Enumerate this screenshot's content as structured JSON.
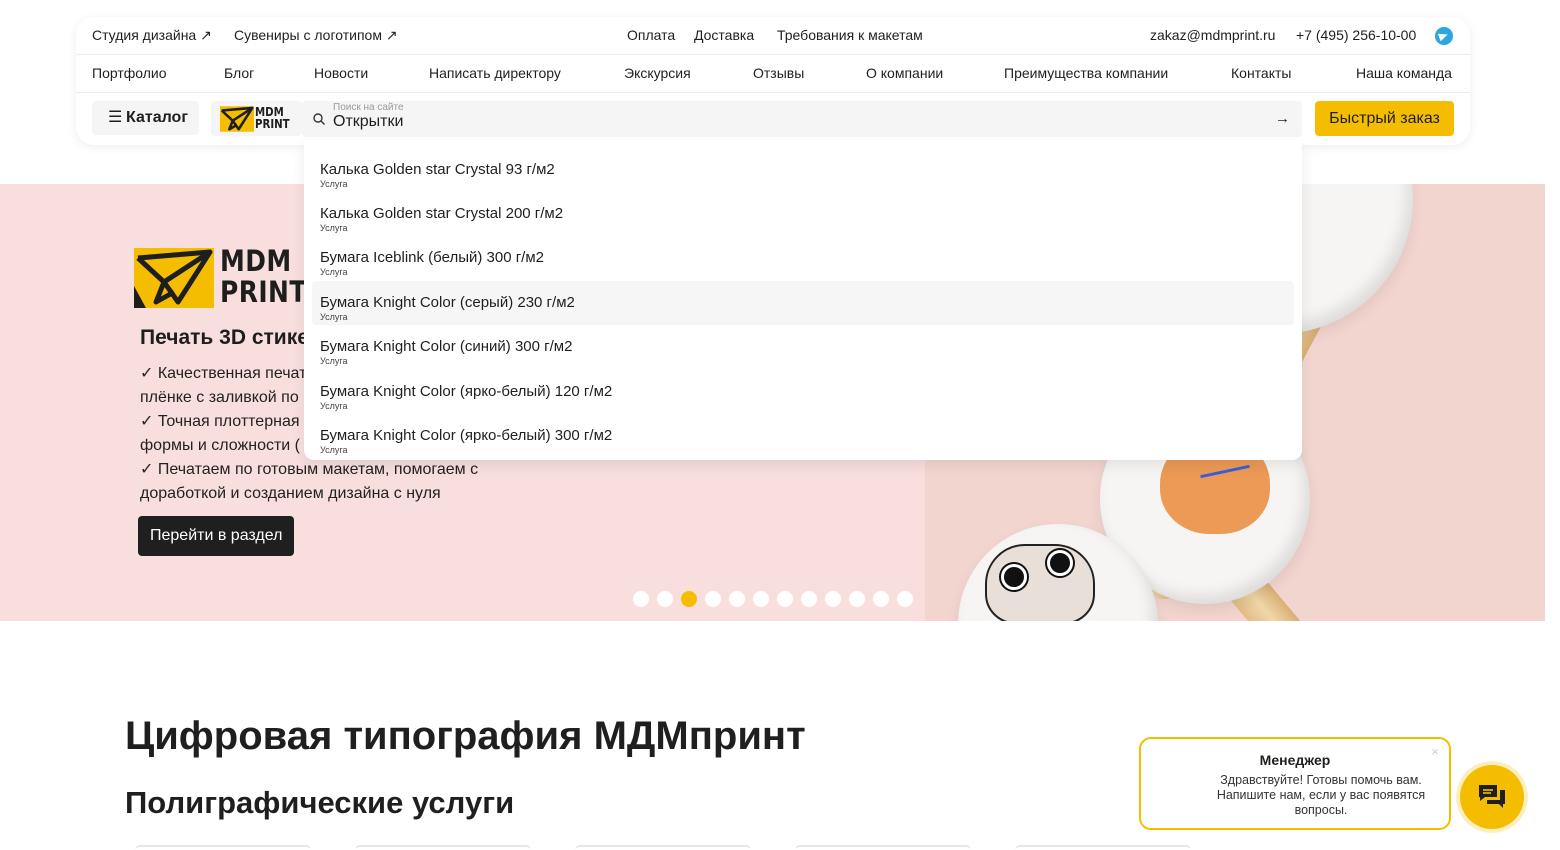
{
  "header": {
    "top_links": [
      "Студия дизайна ↗",
      "Сувениры с логотипом ↗"
    ],
    "info_links": [
      "Оплата",
      "Доставка",
      "Требования к макетам"
    ],
    "email": "zakaz@mdmprint.ru",
    "phone": "+7 (495) 256-10-00",
    "nav": [
      "Портфолио",
      "Блог",
      "Новости",
      "Написать директору",
      "Экскурсия",
      "Отзывы",
      "О компании",
      "Преимущества компании",
      "Контакты",
      "Наша команда"
    ],
    "catalog_label": "Каталог",
    "catalog_icon": "☰",
    "logo_text": [
      "MDM",
      "PRINT"
    ],
    "search_placeholder": "Поиск на сайте",
    "search_value": "Открытки",
    "search_arrow": "→",
    "quick_order": "Быстрый заказ"
  },
  "suggestions": [
    {
      "title": "Калька Golden star Crystal 93 г/м2",
      "type": "Услуга"
    },
    {
      "title": "Калька Golden star Crystal 200 г/м2",
      "type": "Услуга"
    },
    {
      "title": "Бумага Iceblink (белый) 300 г/м2",
      "type": "Услуга"
    },
    {
      "title": "Бумага Knight Color (серый) 230 г/м2",
      "type": "Услуга"
    },
    {
      "title": "Бумага Knight Color (синий) 300 г/м2",
      "type": "Услуга"
    },
    {
      "title": "Бумага Knight Color (ярко-белый) 120 г/м2",
      "type": "Услуга"
    },
    {
      "title": "Бумага Knight Color (ярко-белый) 300 г/м2",
      "type": "Услуга"
    }
  ],
  "hero": {
    "logo_text": [
      "MDM",
      "PRINT"
    ],
    "title": "Печать 3D стике",
    "lines": [
      "✓ Качественная печат",
      "плёнке с заливкой по",
      "✓ Точная плоттерная",
      "формы и сложности (",
      "✓ Печатаем по готовым макетам, помогаем с",
      "доработкой и созданием дизайна с нуля"
    ],
    "button": "Перейти в раздел",
    "slides_total": 12,
    "active_slide": 3
  },
  "main": {
    "title": "Цифровая типография МДМпринт",
    "subtitle": "Полиграфические услуги"
  },
  "chat": {
    "title": "Менеджер",
    "message": "Здравствуйте! Готовы помочь вам. Напишите нам, если у вас появятся вопросы.",
    "close": "×"
  },
  "colors": {
    "accent": "#f5bd00",
    "hero_bg": "#f8dfde",
    "dark": "#1f1f1f",
    "telegram": "#2ca5e0"
  },
  "icons": [
    "external-link-icon",
    "telegram-icon",
    "menu-icon",
    "search-icon",
    "arrow-right-icon",
    "close-icon",
    "chat-icon",
    "paper-plane-logo-icon"
  ]
}
